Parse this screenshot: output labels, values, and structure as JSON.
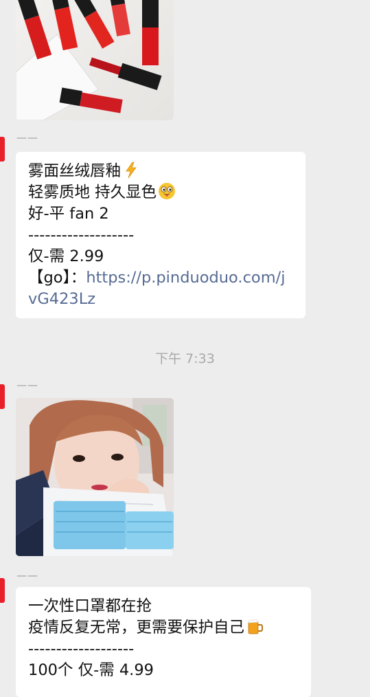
{
  "messages": [
    {
      "type": "image",
      "image_label": "lipstick-product-photo"
    },
    {
      "type": "text",
      "sender": "——",
      "lines": [
        "雾面丝绒唇釉",
        "轻雾质地 持久显色",
        "好-平 fan 2",
        "-------------------",
        "仅-需 2.99"
      ],
      "go_prefix": "【go】：",
      "link_part1": "https://p.pinduoduo.com/j",
      "link_part2": "vG423Lz",
      "emoji_1": "lightning-emoji",
      "emoji_2": "tongue-out-face-emoji"
    },
    {
      "type": "timestamp",
      "text": "下午 7:33"
    },
    {
      "type": "image",
      "sender": "——",
      "image_label": "girl-with-face-masks-photo"
    },
    {
      "type": "text",
      "sender": "——",
      "lines": [
        "一次性口罩都在抢",
        "疫情反复无常，更需要保护自己",
        "-------------------",
        "100个 仅-需 4.99"
      ],
      "emoji_1": "beer-mug-emoji"
    }
  ],
  "colors": {
    "background": "#ededed",
    "bubble": "#ffffff",
    "link": "#576b95",
    "avatar_stub": "#e8202a"
  }
}
